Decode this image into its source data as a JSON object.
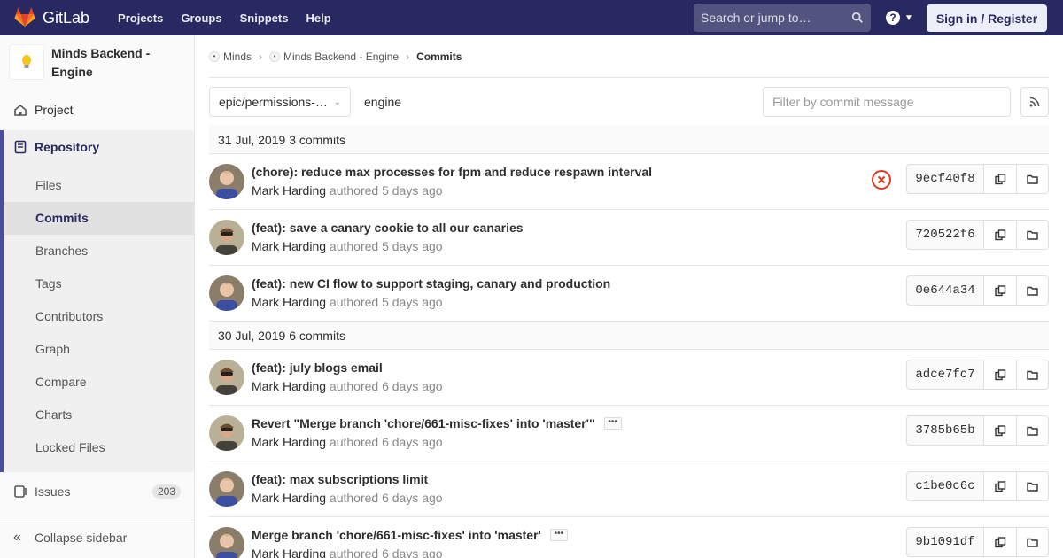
{
  "navbar": {
    "brand": "GitLab",
    "links": [
      "Projects",
      "Groups",
      "Snippets",
      "Help"
    ],
    "search_placeholder": "Search or jump to…",
    "signin_label": "Sign in / Register",
    "help_glyph": "?"
  },
  "sidebar": {
    "project_name": "Minds Backend - Engine",
    "project_label": "Project",
    "repository_label": "Repository",
    "repo_items": [
      "Files",
      "Commits",
      "Branches",
      "Tags",
      "Contributors",
      "Graph",
      "Compare",
      "Charts",
      "Locked Files"
    ],
    "active_item": "Commits",
    "issues_label": "Issues",
    "issues_count": "203",
    "collapse_label": "Collapse sidebar"
  },
  "breadcrumb": {
    "items": [
      "Minds",
      "Minds Backend - Engine",
      "Commits"
    ]
  },
  "toolbar": {
    "branch": "epic/permissions-…",
    "path": "engine",
    "filter_placeholder": "Filter by commit message"
  },
  "days": [
    {
      "date": "31 Jul, 2019",
      "count_label": "3 commits",
      "commits": [
        {
          "title": "(chore): reduce max processes for fpm and reduce respawn interval",
          "author": "Mark Harding",
          "authored": "authored",
          "time": "5 days ago",
          "sha": "9ecf40f8",
          "status": "failed",
          "has_more": false
        },
        {
          "title": "(feat): save a canary cookie to all our canaries",
          "author": "Mark Harding",
          "authored": "authored",
          "time": "5 days ago",
          "sha": "720522f6",
          "status": "",
          "has_more": false
        },
        {
          "title": "(feat): new CI flow to support staging, canary and production",
          "author": "Mark Harding",
          "authored": "authored",
          "time": "5 days ago",
          "sha": "0e644a34",
          "status": "",
          "has_more": false
        }
      ]
    },
    {
      "date": "30 Jul, 2019",
      "count_label": "6 commits",
      "commits": [
        {
          "title": "(feat): july blogs email",
          "author": "Mark Harding",
          "authored": "authored",
          "time": "6 days ago",
          "sha": "adce7fc7",
          "status": "",
          "has_more": false
        },
        {
          "title": "Revert \"Merge branch 'chore/661-misc-fixes' into 'master'\"",
          "author": "Mark Harding",
          "authored": "authored",
          "time": "6 days ago",
          "sha": "3785b65b",
          "status": "",
          "has_more": true
        },
        {
          "title": "(feat): max subscriptions limit",
          "author": "Mark Harding",
          "authored": "authored",
          "time": "6 days ago",
          "sha": "c1be0c6c",
          "status": "",
          "has_more": false
        },
        {
          "title": "Merge branch 'chore/661-misc-fixes' into 'master'",
          "author": "Mark Harding",
          "authored": "authored",
          "time": "6 days ago",
          "sha": "9b1091df",
          "status": "",
          "has_more": true
        }
      ]
    }
  ],
  "colors": {
    "navbar": "#292961",
    "accent": "#4b4ba3",
    "failed": "#db3b21"
  }
}
